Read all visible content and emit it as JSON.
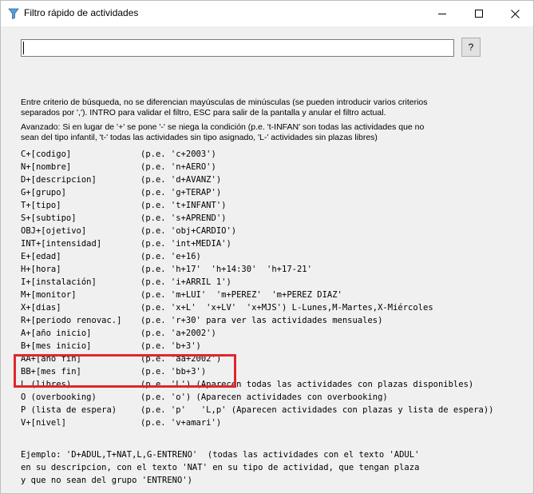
{
  "window": {
    "title": "Filtro rápido de actividades",
    "icon": "filter-funnel-icon",
    "controls": {
      "minimize": "–",
      "maximize": "□",
      "close": "✕"
    }
  },
  "search": {
    "value": "",
    "placeholder": "",
    "help_label": "?"
  },
  "intro": {
    "line1": "Entre criterio de búsqueda, no se diferencian mayúsculas de minúsculas (se pueden introducir varios criterios separados por ','). INTRO para validar el filtro, ESC para salir de la pantalla y anular el filtro actual.",
    "line2": "Avanzado: Si en lugar de '+' se pone '-' se niega la condición (p.e. 't-INFAN' son todas las actividades que no sean del tipo infantil, 't-' todas las actividades sin tipo asignado, 'L-' actividades sin plazas libres)"
  },
  "criteria": [
    {
      "code": "C+[codigo]",
      "example": "(p.e. 'c+2003')"
    },
    {
      "code": "N+[nombre]",
      "example": "(p.e. 'n+AERO')"
    },
    {
      "code": "D+[descripcion]",
      "example": "(p.e. 'd+AVANZ')"
    },
    {
      "code": "G+[grupo]",
      "example": "(p.e. 'g+TERAP')"
    },
    {
      "code": "T+[tipo]",
      "example": "(p.e. 't+INFANT')"
    },
    {
      "code": "S+[subtipo]",
      "example": "(p.e. 's+APREND')"
    },
    {
      "code": "OBJ+[ojetivo]",
      "example": "(p.e. 'obj+CARDIO')"
    },
    {
      "code": "INT+[intensidad]",
      "example": "(p.e. 'int+MEDIA')"
    },
    {
      "code": "E+[edad]",
      "example": "(p.e. 'e+16)"
    },
    {
      "code": "H+[hora]",
      "example": "(p.e. 'h+17'  'h+14:30'  'h+17-21'"
    },
    {
      "code": "I+[instalación]",
      "example": "(p.e. 'i+ARRIL 1')"
    },
    {
      "code": "M+[monitor]",
      "example": "(p.e. 'm+LUI'  'm+PEREZ'  'm+PEREZ DIAZ'"
    },
    {
      "code": "X+[dias]",
      "example": "(p.e. 'x+L'  'x+LV'  'x+MJS') L-Lunes,M-Martes,X-Miércoles"
    },
    {
      "code": "R+[periodo renovac.]",
      "example": "(p.e. 'r+30' para ver las actividades mensuales)"
    },
    {
      "code": "A+[año inicio]",
      "example": "(p.e. 'a+2002')"
    },
    {
      "code": "B+[mes inicio]",
      "example": "(p.e. 'b+3')"
    },
    {
      "code": "AA+[año fin]",
      "example": "(p.e. 'aa+2002')"
    },
    {
      "code": "BB+[mes fin]",
      "example": "(p.e. 'bb+3')"
    },
    {
      "code": "L (libres)",
      "example": "(p.e. 'L') (Aparecen todas las actividades con plazas disponibles)"
    },
    {
      "code": "O (overbooking)",
      "example": "(p.e. 'o') (Aparecen actividades con overbooking)"
    },
    {
      "code": "P (lista de espera)",
      "example": "(p.e. 'p'   'L,p' (Aparecen actividades con plazas y lista de espera))"
    },
    {
      "code": "V+[nivel]",
      "example": "(p.e. 'v+amari')"
    }
  ],
  "example_block": {
    "line1": "Ejemplo: 'D+ADUL,T+NAT,L,G-ENTRENO'  (todas las actividades con el texto 'ADUL'",
    "line2": "en su descripcion, con el texto 'NAT' en su tipo de actividad, que tengan plaza",
    "line3": "y que no sean del grupo 'ENTRENO')"
  },
  "highlight_color": "#e0262f"
}
